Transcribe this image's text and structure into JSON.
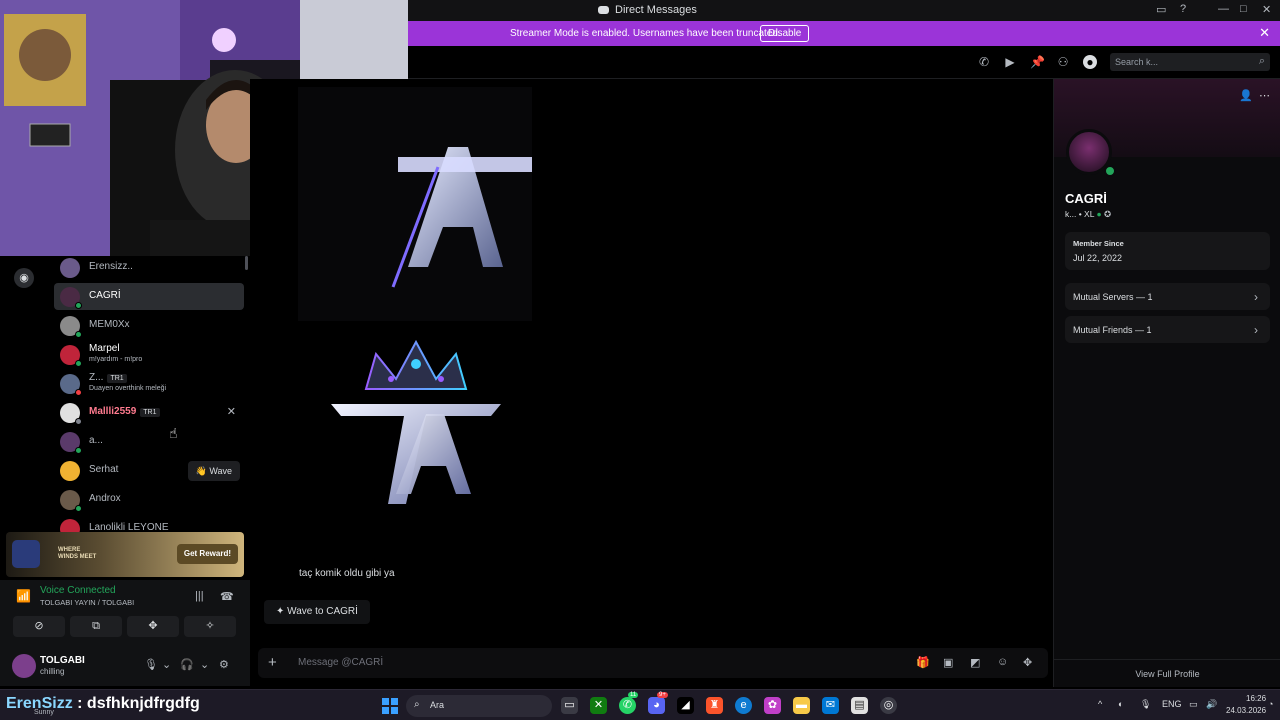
{
  "window": {
    "title": "Direct Messages"
  },
  "streamer_banner": {
    "message": "Streamer Mode is enabled. Usernames have been truncated.",
    "disable_label": "Disable",
    "color": "#9b34d8"
  },
  "header": {
    "search_placeholder": "Search k..."
  },
  "dm_list": {
    "items": [
      {
        "name": "Erensizz..",
        "sub": "",
        "tag": ""
      },
      {
        "name": "CAGRİ",
        "sub": "",
        "tag": ""
      },
      {
        "name": "MEM0Xx",
        "sub": "",
        "tag": ""
      },
      {
        "name": "Marpel",
        "sub": "m!yardım - m!pro",
        "tag": ""
      },
      {
        "name": "Z...",
        "sub": "Duayen overthink meleği",
        "tag": "TR1"
      },
      {
        "name": "Mallli2559",
        "sub": "",
        "tag": "TR1"
      },
      {
        "name": "a...",
        "sub": "",
        "tag": ""
      },
      {
        "name": "Serhat",
        "sub": "",
        "tag": ""
      },
      {
        "name": "Androx",
        "sub": "",
        "tag": ""
      },
      {
        "name": "Lanolikli LEYONE",
        "sub": "",
        "tag": ""
      }
    ],
    "wave_label": "Wave"
  },
  "promo": {
    "game_name": "WHERE WINDS MEET",
    "button_label": "Get Reward!"
  },
  "voice": {
    "status": "Voice Connected",
    "channel": "TOLGABI YAYIN / TOLGABI"
  },
  "user_panel": {
    "username": "TOLGABI",
    "status": "chilling"
  },
  "chat": {
    "message_text": "taç komik oldu gibi ya",
    "wave_button": "Wave to CAGRİ",
    "composer_placeholder": "Message @CAGRİ"
  },
  "profile": {
    "name": "CAGRİ",
    "tagline": "k... • XL",
    "member_since_label": "Member Since",
    "member_since_value": "Jul 22, 2022",
    "mutual_servers": "Mutual Servers — 1",
    "mutual_friends": "Mutual Friends — 1",
    "view_full": "View Full Profile"
  },
  "overlay_chat": {
    "name": "ErenSizz",
    "message": ": dsfhknjdfrgdfg",
    "sub": "Sunny"
  },
  "taskbar": {
    "search_label": "Ara",
    "language": "ENG",
    "time": "16:26",
    "date": "24.03.2026",
    "whatsapp_badge": "11",
    "discord_badge": "9+"
  },
  "colors": {
    "accent": "#9b34d8",
    "online": "#23a55a",
    "background": "#000000"
  }
}
